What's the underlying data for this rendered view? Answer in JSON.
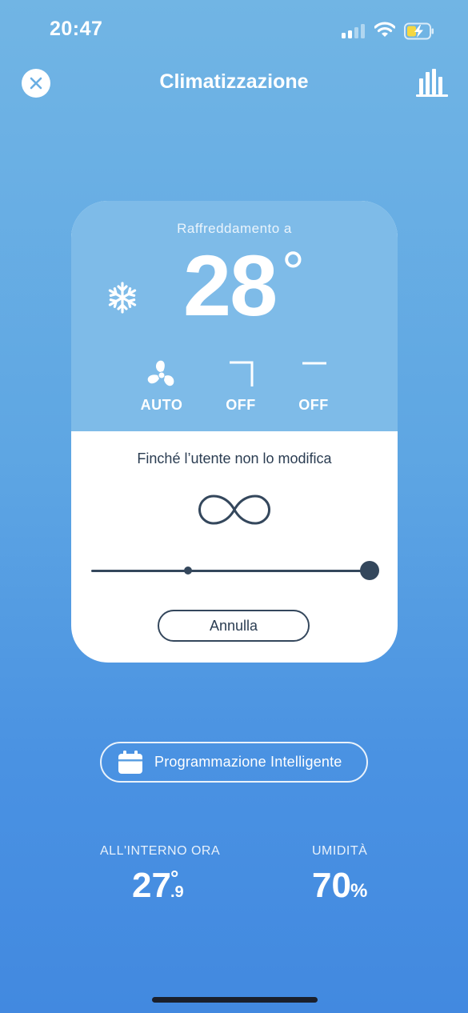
{
  "status_bar": {
    "time": "20:47"
  },
  "header": {
    "title": "Climatizzazione"
  },
  "thermostat": {
    "mode_label": "Raffreddamento a",
    "setpoint": "28",
    "degree_symbol": "°",
    "controls": [
      {
        "icon": "fan-icon",
        "label": "AUTO"
      },
      {
        "icon": "vane-vertical-icon",
        "label": "OFF"
      },
      {
        "icon": "vane-horizontal-icon",
        "label": "OFF"
      }
    ]
  },
  "timer": {
    "text": "Finché l’utente non lo modifica",
    "slider_value": 1.0,
    "cancel_label": "Annulla"
  },
  "smart_schedule": {
    "label": "Programmazione Intelligente"
  },
  "stats": {
    "indoor": {
      "label": "ALL'INTERNO ORA",
      "value": "27",
      "degree": "°",
      "decimal": ".9"
    },
    "humidity": {
      "label": "UMIDITÀ",
      "value": "70",
      "unit": "%"
    }
  },
  "colors": {
    "card_top": "#7ebbe8",
    "dark": "#34475c",
    "background_top": "#71b5e4",
    "background_bottom": "#4289e0"
  }
}
